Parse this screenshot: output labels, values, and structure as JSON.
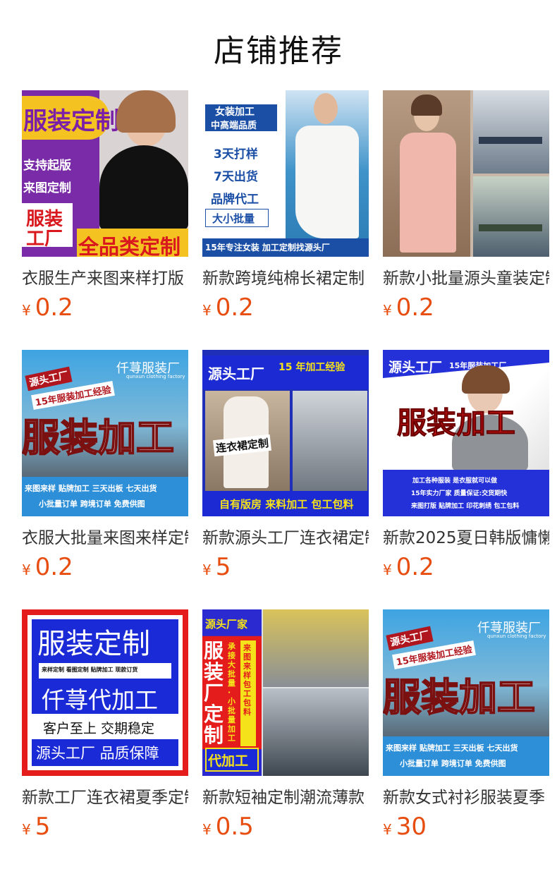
{
  "page": {
    "title": "店铺推荐"
  },
  "products": [
    {
      "name": "衣服生产来图来样打版",
      "currency": "¥",
      "price": "0.2",
      "thumb": {
        "t1": "服装定制",
        "t2": "支持起版",
        "t3": "来图定制",
        "t4": "服装",
        "t5": "工厂",
        "t6": "全品类定制"
      }
    },
    {
      "name": "新款跨境纯棉长裙定制",
      "currency": "¥",
      "price": "0.2",
      "thumb": {
        "t1": "女装加工",
        "t2": "中高端品质",
        "t3": "3天打样",
        "t4": "7天出货",
        "t5": "品牌代工",
        "t6": "大小批量",
        "t7": "15年专注女装 加工定制找源头厂"
      }
    },
    {
      "name": "新款小批量源头童装定制",
      "currency": "¥",
      "price": "0.2",
      "thumb": {}
    },
    {
      "name": "衣服大批量来图来样定制",
      "currency": "¥",
      "price": "0.2",
      "thumb": {
        "t1": "源头工厂",
        "t2": "15年服装加工经验",
        "t3": "仟荨服装厂",
        "t4": "qunxun clothing factory",
        "t5": "服装加工",
        "t6": "来图来样  贴牌加工  三天出板  七天出货",
        "t7": "小批量订单  跨境订单   免费供图"
      }
    },
    {
      "name": "新款源头工厂连衣裙定制",
      "currency": "¥",
      "price": "5",
      "thumb": {
        "t1": "源头工厂",
        "t2": "15 年加工经验",
        "t3": "连衣裙定制",
        "t4": "自有版房 来料加工 包工包料"
      }
    },
    {
      "name": "新款2025夏日韩版慵懒",
      "currency": "¥",
      "price": "0.2",
      "thumb": {
        "t1": "源头工厂",
        "t2": "15年服装加工厂",
        "t3": "服装加工",
        "t4": "加工各种服装 是衣服就可以做",
        "t5": "15年实力厂家 质量保证:交货期快",
        "t6": "来图打版 贴牌加工 印花刺绣 包工包料"
      }
    },
    {
      "name": "新款工厂连衣裙夏季定制",
      "currency": "¥",
      "price": "5",
      "thumb": {
        "t1": "服装定制",
        "t2": "来样定制  看图定制  贴牌加工  现款订货",
        "t3": "仟荨代加工",
        "t4": "客户至上 交期稳定",
        "t5": "源头工厂 品质保障"
      }
    },
    {
      "name": "新款短袖定制潮流薄款",
      "currency": "¥",
      "price": "0.5",
      "thumb": {
        "t1": "源头厂家",
        "t2": "服装厂定制",
        "t3": "承接大批量·小批量加工",
        "t4": "来图来样 包工包料",
        "t5": "代加工"
      }
    },
    {
      "name": "新款女式衬衫服装夏季",
      "currency": "¥",
      "price": "30",
      "thumb": {
        "t1": "源头工厂",
        "t2": "15年服装加工经验",
        "t3": "仟荨服装厂",
        "t4": "qunxun clothing factory",
        "t5": "服装加工",
        "t6": "来图来样  贴牌加工  三天出板  七天出货",
        "t7": "小批量订单  跨境订单   免费供图"
      }
    }
  ]
}
